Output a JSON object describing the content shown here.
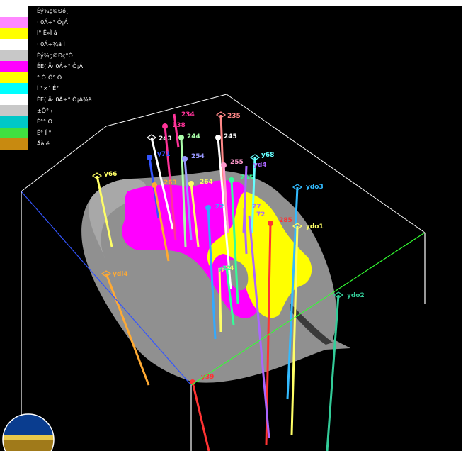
{
  "viewer": {
    "background": "#000000",
    "frame_color": "#ffffff"
  },
  "legend": [
    {
      "label": "Éý¾ç©Ðó¸",
      "color": "#ffffff"
    },
    {
      "label": "· 0Á÷° Ó¡Á",
      "color": "#ff88ff"
    },
    {
      "label": "Í° Ë»Ì â",
      "color": "#ffff00"
    },
    {
      "label": "· 0Á÷¾ä Ì ",
      "color": "#ffffff"
    },
    {
      "label": "Éý¾ç©Ðç°Ó¡",
      "color": "#c8c8c8"
    },
    {
      "label": "ÉÈ( Ã· 0Á÷° Ó¡Á",
      "color": "#ff00ff"
    },
    {
      "label": "° Ó¡Ô° Ó",
      "color": "#ffff00"
    },
    {
      "label": "Í °×´ É°",
      "color": "#00ffff"
    },
    {
      "label": "ÉÈ( Ã· 0Á÷° Ó¡Á¾ä",
      "color": "#ffffff"
    },
    {
      "label": "±Õ° ›",
      "color": "#c8c8c8"
    },
    {
      "label": "É°° Ó",
      "color": "#00c8c8"
    },
    {
      "label": "É° Í °",
      "color": "#40e040"
    },
    {
      "label": "Äà ë",
      "color": "#c88a10"
    }
  ],
  "wells": [
    {
      "name": "243",
      "color": "#ffffff",
      "head": "open"
    },
    {
      "name": "138",
      "color": "#ff3399",
      "head": "ball"
    },
    {
      "name": "234",
      "color": "#ff3399",
      "head": "none"
    },
    {
      "name": "235",
      "color": "#ff8888",
      "head": "open"
    },
    {
      "name": "244",
      "color": "#aaffaa",
      "head": "ball"
    },
    {
      "name": "245",
      "color": "#ffffff",
      "head": "ball"
    },
    {
      "name": "254",
      "color": "#9999ff",
      "head": "ball"
    },
    {
      "name": "255",
      "color": "#ff99cc",
      "head": "ball"
    },
    {
      "name": "y71",
      "color": "#3355ff",
      "head": "ball"
    },
    {
      "name": "y68",
      "color": "#66ffff",
      "head": "open"
    },
    {
      "name": "y66",
      "color": "#ffff66",
      "head": "open"
    },
    {
      "name": "263",
      "color": "#ffaa33",
      "head": "ball"
    },
    {
      "name": "264",
      "color": "#ffff66",
      "head": "ball"
    },
    {
      "name": "265",
      "color": "#33ff99",
      "head": "ball"
    },
    {
      "name": "ydo3",
      "color": "#33bbff",
      "head": "open"
    },
    {
      "name": "ydo1",
      "color": "#ffff66",
      "head": "open"
    },
    {
      "name": "285",
      "color": "#ff3333",
      "head": "ball"
    },
    {
      "name": "ydo2",
      "color": "#33cc99",
      "head": "open"
    },
    {
      "name": "ydl4",
      "color": "#ffaa33",
      "head": "open"
    },
    {
      "name": "y39",
      "color": "#ff3333",
      "head": "ball"
    },
    {
      "name": "27",
      "color": "#aa66ff",
      "head": "none"
    },
    {
      "name": "yd4",
      "color": "#aa66ff",
      "head": "none"
    },
    {
      "name": "22",
      "color": "#33aaff",
      "head": "ball"
    },
    {
      "name": "y24",
      "color": "#ffff66",
      "head": "none"
    },
    {
      "name": "72",
      "color": "#aa66ff",
      "head": "none"
    },
    {
      "name": "y32",
      "color": "#33ff99",
      "head": "none"
    }
  ],
  "compass": {
    "top_color": "#0a3d8f",
    "bottom_color": "#a07a1a",
    "band_color": "#e8c84a"
  }
}
